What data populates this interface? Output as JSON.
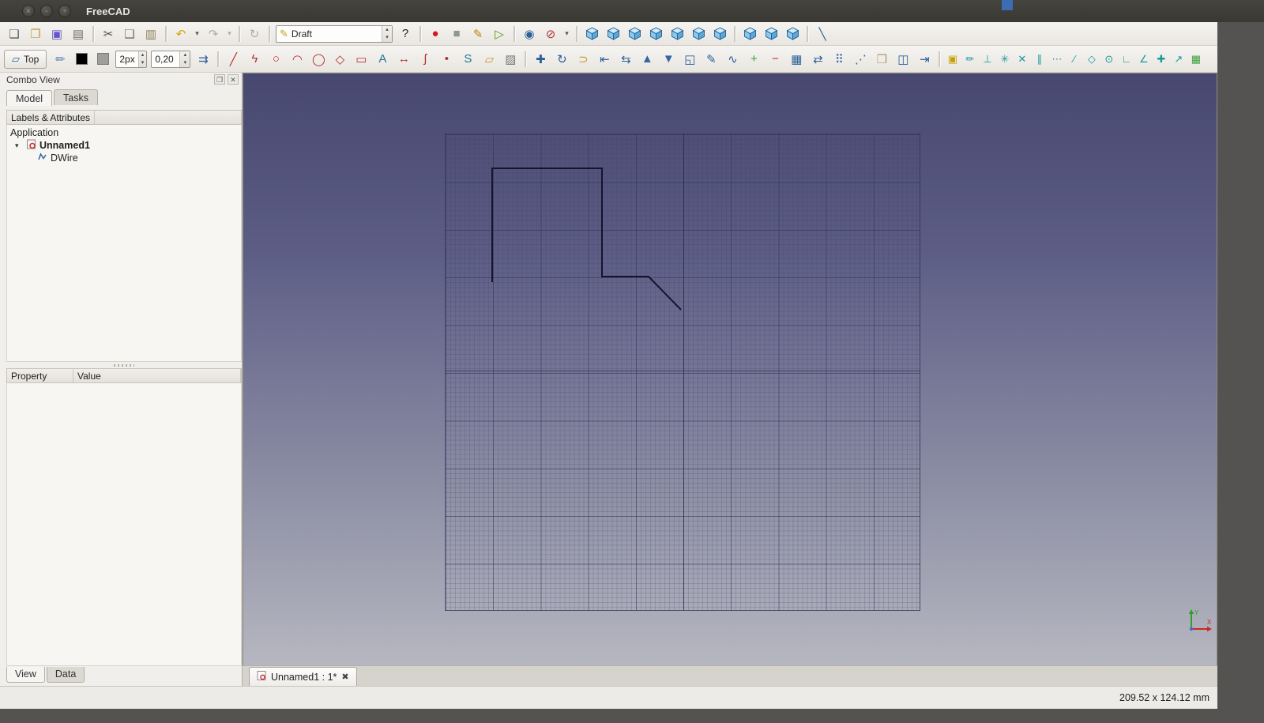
{
  "titlebar": {
    "title": "FreeCAD",
    "buttons": [
      {
        "name": "close-button",
        "glyph": "✕"
      },
      {
        "name": "minimize-button",
        "glyph": "−"
      },
      {
        "name": "maximize-button",
        "glyph": "+"
      }
    ]
  },
  "toolbars": {
    "standard": [
      {
        "kind": "btn",
        "name": "new-file-icon",
        "glyph": "❏",
        "color": "#5b5b5b"
      },
      {
        "kind": "btn",
        "name": "open-file-icon",
        "glyph": "❐",
        "color": "#c09a3e"
      },
      {
        "kind": "btn",
        "name": "save-icon",
        "glyph": "▣",
        "color": "#6456c9"
      },
      {
        "kind": "btn",
        "name": "print-icon",
        "glyph": "▤",
        "color": "#6e6e6e"
      },
      {
        "kind": "sep"
      },
      {
        "kind": "btn",
        "name": "cut-icon",
        "glyph": "✂",
        "color": "#4a4a4a"
      },
      {
        "kind": "btn",
        "name": "copy-icon",
        "glyph": "❑",
        "color": "#6e6e6e"
      },
      {
        "kind": "btn",
        "name": "paste-icon",
        "glyph": "▥",
        "color": "#8a7f57"
      },
      {
        "kind": "sep"
      },
      {
        "kind": "btn",
        "name": "undo-icon",
        "glyph": "↶",
        "color": "#d7a400"
      },
      {
        "kind": "btn",
        "name": "undo-menu-icon",
        "glyph": "▾",
        "color": "#555555",
        "narrow": true
      },
      {
        "kind": "btn",
        "name": "redo-icon",
        "glyph": "↷",
        "color": "#b0ada7"
      },
      {
        "kind": "btn",
        "name": "redo-menu-icon",
        "glyph": "▾",
        "color": "#b0ada7",
        "narrow": true
      },
      {
        "kind": "sep"
      },
      {
        "kind": "btn",
        "name": "refresh-icon",
        "glyph": "↻",
        "color": "#b0ada7"
      },
      {
        "kind": "sep"
      },
      {
        "kind": "combo",
        "name": "workbench-selector",
        "value": "Draft",
        "icon_name": "draft-workbench-icon",
        "icon_glyph": "✎",
        "icon_color": "#c9a227"
      },
      {
        "kind": "btn",
        "name": "whatsthis-icon",
        "glyph": "?",
        "color": "#222222"
      },
      {
        "kind": "sep"
      },
      {
        "kind": "btn",
        "name": "macro-record-icon",
        "glyph": "●",
        "color": "#d11a1a"
      },
      {
        "kind": "btn",
        "name": "macro-stop-icon",
        "glyph": "■",
        "color": "#8f988f"
      },
      {
        "kind": "btn",
        "name": "macro-edit-icon",
        "glyph": "✎",
        "color": "#b8860b"
      },
      {
        "kind": "btn",
        "name": "macro-play-icon",
        "glyph": "▷",
        "color": "#4e9a06"
      },
      {
        "kind": "sep"
      },
      {
        "kind": "btn",
        "name": "fit-all-icon",
        "glyph": "◉",
        "color": "#2a6099"
      },
      {
        "kind": "btn",
        "name": "draw-style-icon",
        "glyph": "⊘",
        "color": "#b33333"
      },
      {
        "kind": "btn",
        "name": "draw-style-menu-icon",
        "glyph": "▾",
        "color": "#555555",
        "narrow": true
      },
      {
        "kind": "sep"
      },
      {
        "kind": "cube",
        "name": "axonometric-view-icon"
      },
      {
        "kind": "cube",
        "name": "front-view-icon"
      },
      {
        "kind": "cube",
        "name": "top-view-icon"
      },
      {
        "kind": "cube",
        "name": "right-view-icon"
      },
      {
        "kind": "cube",
        "name": "rear-view-icon"
      },
      {
        "kind": "cube",
        "name": "bottom-view-icon"
      },
      {
        "kind": "cube",
        "name": "left-view-icon"
      },
      {
        "kind": "sep"
      },
      {
        "kind": "cube",
        "name": "isometric-view-icon"
      },
      {
        "kind": "cube",
        "name": "dimetric-view-icon"
      },
      {
        "kind": "cube",
        "name": "trimetric-view-icon"
      },
      {
        "kind": "sep"
      },
      {
        "kind": "btn",
        "name": "measure-distance-icon",
        "glyph": "╲",
        "color": "#2a6099"
      }
    ],
    "draft": [
      {
        "kind": "label-btn",
        "name": "working-plane-button",
        "label": "Top",
        "icon_name": "plane-icon",
        "icon_glyph": "▱",
        "icon_color": "#2a6099"
      },
      {
        "kind": "btn",
        "name": "construction-mode-icon",
        "glyph": "✏",
        "color": "#5f7fa8"
      },
      {
        "kind": "swatch",
        "name": "line-color-swatch",
        "color": "#000000"
      },
      {
        "kind": "swatch",
        "name": "face-color-swatch",
        "color": "#9e9e9e"
      },
      {
        "kind": "spin",
        "name": "line-width-spinner",
        "value": "2px",
        "width": 40
      },
      {
        "kind": "spin",
        "name": "text-scale-spinner",
        "value": "0,20",
        "width": 50
      },
      {
        "kind": "btn",
        "name": "autogroup-icon",
        "glyph": "⇉",
        "color": "#2a6099"
      },
      {
        "kind": "sep"
      },
      {
        "kind": "btn",
        "name": "line-tool-icon",
        "glyph": "╱",
        "color": "#b03030"
      },
      {
        "kind": "btn",
        "name": "polyline-tool-icon",
        "glyph": "ϟ",
        "color": "#b03030"
      },
      {
        "kind": "btn",
        "name": "circle-tool-icon",
        "glyph": "○",
        "color": "#b03030"
      },
      {
        "kind": "btn",
        "name": "arc-tool-icon",
        "glyph": "◠",
        "color": "#b03030"
      },
      {
        "kind": "btn",
        "name": "ellipse-tool-icon",
        "glyph": "◯",
        "color": "#b03030"
      },
      {
        "kind": "btn",
        "name": "polygon-tool-icon",
        "glyph": "◇",
        "color": "#b03030"
      },
      {
        "kind": "btn",
        "name": "rectangle-tool-icon",
        "glyph": "▭",
        "color": "#b03030"
      },
      {
        "kind": "btn",
        "name": "text-tool-icon",
        "glyph": "A",
        "color": "#1f7a8c"
      },
      {
        "kind": "btn",
        "name": "dimension-tool-icon",
        "glyph": "↔",
        "color": "#b03030"
      },
      {
        "kind": "btn",
        "name": "bspline-tool-icon",
        "glyph": "ʃ",
        "color": "#b03030"
      },
      {
        "kind": "btn",
        "name": "point-tool-icon",
        "glyph": "•",
        "color": "#b03030"
      },
      {
        "kind": "btn",
        "name": "shapestring-tool-icon",
        "glyph": "S",
        "color": "#1f7a8c"
      },
      {
        "kind": "btn",
        "name": "facebinder-tool-icon",
        "glyph": "▱",
        "color": "#c59a2f"
      },
      {
        "kind": "btn",
        "name": "hatch-tool-icon",
        "glyph": "▨",
        "color": "#777777"
      },
      {
        "kind": "sep"
      },
      {
        "kind": "btn",
        "name": "move-tool-icon",
        "glyph": "✚",
        "color": "#2a6099"
      },
      {
        "kind": "btn",
        "name": "rotate-tool-icon",
        "glyph": "↻",
        "color": "#2a6099"
      },
      {
        "kind": "btn",
        "name": "offset-tool-icon",
        "glyph": "⊃",
        "color": "#c59a2f"
      },
      {
        "kind": "btn",
        "name": "trimex-tool-icon",
        "glyph": "⇤",
        "color": "#2a6099"
      },
      {
        "kind": "btn",
        "name": "stretch-tool-icon",
        "glyph": "⇆",
        "color": "#2a6099"
      },
      {
        "kind": "btn",
        "name": "upgrade-tool-icon",
        "glyph": "▲",
        "color": "#3465a4"
      },
      {
        "kind": "btn",
        "name": "downgrade-tool-icon",
        "glyph": "▼",
        "color": "#3465a4"
      },
      {
        "kind": "btn",
        "name": "scale-tool-icon",
        "glyph": "◱",
        "color": "#2a6099"
      },
      {
        "kind": "btn",
        "name": "edit-tool-icon",
        "glyph": "✎",
        "color": "#2a6099"
      },
      {
        "kind": "btn",
        "name": "wire-to-bspline-icon",
        "glyph": "∿",
        "color": "#2a6099"
      },
      {
        "kind": "btn",
        "name": "add-point-icon",
        "glyph": "+",
        "color": "#3d9e3d"
      },
      {
        "kind": "btn",
        "name": "remove-point-icon",
        "glyph": "−",
        "color": "#c03030"
      },
      {
        "kind": "btn",
        "name": "shape-2d-view-icon",
        "glyph": "▦",
        "color": "#2a6099"
      },
      {
        "kind": "btn",
        "name": "draft-to-sketch-icon",
        "glyph": "⇄",
        "color": "#2a6099"
      },
      {
        "kind": "btn",
        "name": "array-tool-icon",
        "glyph": "⠿",
        "color": "#3465a4"
      },
      {
        "kind": "btn",
        "name": "path-array-icon",
        "glyph": "⋰",
        "color": "#3465a4"
      },
      {
        "kind": "btn",
        "name": "clone-tool-icon",
        "glyph": "❒",
        "color": "#b09a6a"
      },
      {
        "kind": "btn",
        "name": "mirror-tool-icon",
        "glyph": "◫",
        "color": "#2a6099"
      },
      {
        "kind": "btn",
        "name": "move-to-group-icon",
        "glyph": "⇥",
        "color": "#2a6099"
      },
      {
        "kind": "sep"
      },
      {
        "kind": "btn",
        "name": "snap-lock-icon",
        "glyph": "▣",
        "color": "#c4a000",
        "small": true
      },
      {
        "kind": "btn",
        "name": "snap-endpoint-icon",
        "glyph": "✏",
        "color": "#159b9b",
        "small": true
      },
      {
        "kind": "btn",
        "name": "snap-perpendicular-icon",
        "glyph": "⊥",
        "color": "#159b9b",
        "small": true
      },
      {
        "kind": "btn",
        "name": "snap-grid-icon",
        "glyph": "✳",
        "color": "#159b9b",
        "small": true
      },
      {
        "kind": "btn",
        "name": "snap-intersection-icon",
        "glyph": "✕",
        "color": "#159b9b",
        "small": true
      },
      {
        "kind": "btn",
        "name": "snap-parallel-icon",
        "glyph": "∥",
        "color": "#159b9b",
        "small": true
      },
      {
        "kind": "btn",
        "name": "snap-extension-icon",
        "glyph": "⋯",
        "color": "#159b9b",
        "small": true
      },
      {
        "kind": "btn",
        "name": "snap-near-icon",
        "glyph": "∕",
        "color": "#159b9b",
        "small": true
      },
      {
        "kind": "btn",
        "name": "snap-angle-icon",
        "glyph": "◇",
        "color": "#159b9b",
        "small": true
      },
      {
        "kind": "btn",
        "name": "snap-center-icon",
        "glyph": "⊙",
        "color": "#159b9b",
        "small": true
      },
      {
        "kind": "btn",
        "name": "snap-ortho-icon",
        "glyph": "∟",
        "color": "#159b9b",
        "small": true
      },
      {
        "kind": "btn",
        "name": "snap-special-icon",
        "glyph": "∠",
        "color": "#159b9b",
        "small": true
      },
      {
        "kind": "btn",
        "name": "snap-dimensions-icon",
        "glyph": "✚",
        "color": "#159b9b",
        "small": true
      },
      {
        "kind": "btn",
        "name": "snap-working-plane-icon",
        "glyph": "↗",
        "color": "#159b9b",
        "small": true
      },
      {
        "kind": "btn",
        "name": "grid-toggle-icon",
        "glyph": "▦",
        "color": "#3d9e3d",
        "small": true
      }
    ]
  },
  "combo_view": {
    "title": "Combo View",
    "float_glyph": "❐",
    "close_glyph": "✕",
    "tabs": [
      "Model",
      "Tasks"
    ],
    "active_tab": "Model",
    "tree_header": "Labels & Attributes",
    "tree_root": "Application",
    "expander_glyph": "▾",
    "document_name": "Unnamed1",
    "wire_name": "DWire",
    "property_col": "Property",
    "value_col": "Value",
    "bottom_tabs": [
      "View",
      "Data"
    ],
    "active_bottom_tab": "View"
  },
  "viewport": {
    "document_tab": {
      "label": "Unnamed1 : 1*",
      "close_glyph": "✖"
    },
    "axes": {
      "x": "X",
      "y": "Y"
    }
  },
  "statusbar": {
    "dimensions": "209.52 x 124.12 mm"
  },
  "colors": {
    "accent_blue": "#3465a4",
    "viewport_top": "#474870",
    "viewport_bottom": "#b6b7c0",
    "wire_stroke": "#14142a"
  }
}
